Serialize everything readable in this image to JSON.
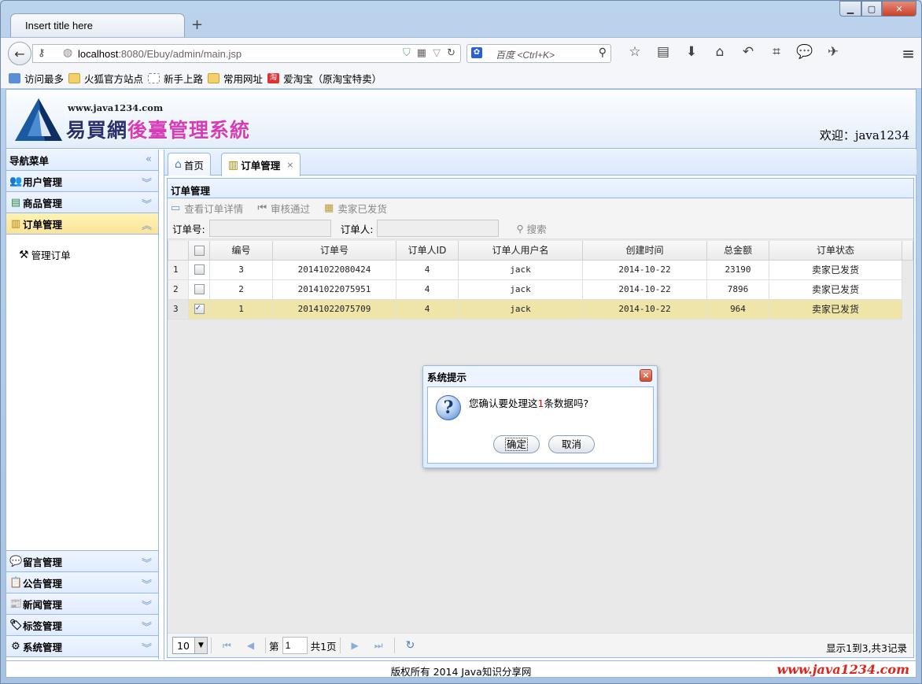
{
  "browser": {
    "tab_title": "Insert title here",
    "new_tab": "+",
    "url_host": "localhost",
    "url_rest": ":8080/Ebuy/admin/main.jsp",
    "search_placeholder": "百度 <Ctrl+K>",
    "bookmarks": [
      "访问最多",
      "火狐官方站点",
      "新手上路",
      "常用网址",
      "爱淘宝（原淘宝特卖）"
    ]
  },
  "header": {
    "site_url": "www.java1234.com",
    "title_part1": "易買網",
    "title_part2": "後臺管理系統",
    "welcome": "欢迎：java1234"
  },
  "nav": {
    "title": "导航菜单",
    "groups_top": [
      {
        "label": "用户管理",
        "icon": "users-icon"
      },
      {
        "label": "商品管理",
        "icon": "list-icon"
      },
      {
        "label": "订单管理",
        "icon": "order-icon"
      }
    ],
    "order_items": [
      {
        "label": "管理订单",
        "icon": "tools-icon"
      }
    ],
    "groups_bottom": [
      {
        "label": "留言管理",
        "icon": "comment-icon"
      },
      {
        "label": "公告管理",
        "icon": "notice-icon"
      },
      {
        "label": "新闻管理",
        "icon": "news-icon"
      },
      {
        "label": "标签管理",
        "icon": "tag-icon"
      },
      {
        "label": "系统管理",
        "icon": "gear-icon"
      }
    ]
  },
  "tabs": [
    {
      "label": "首页"
    },
    {
      "label": "订单管理",
      "close": "×"
    }
  ],
  "content": {
    "title": "订单管理",
    "toolbar": [
      "查看订单详情",
      "审核通过",
      "卖家已发货"
    ],
    "search": {
      "order_no_label": "订单号:",
      "user_label": "订单人:",
      "button": "搜索"
    }
  },
  "grid": {
    "columns": [
      "编号",
      "订单号",
      "订单人ID",
      "订单人用户名",
      "创建时间",
      "总金额",
      "订单状态"
    ],
    "rows": [
      {
        "rownum": "1",
        "checked": false,
        "id": "3",
        "order_no": "20141022080424",
        "user_id": "4",
        "username": "jack",
        "created": "2014-10-22",
        "total": "23190",
        "status": "卖家已发货"
      },
      {
        "rownum": "2",
        "checked": false,
        "id": "2",
        "order_no": "20141022075951",
        "user_id": "4",
        "username": "jack",
        "created": "2014-10-22",
        "total": "7896",
        "status": "卖家已发货"
      },
      {
        "rownum": "3",
        "checked": true,
        "id": "1",
        "order_no": "20141022075709",
        "user_id": "4",
        "username": "jack",
        "created": "2014-10-22",
        "total": "964",
        "status": "卖家已发货"
      }
    ]
  },
  "pager": {
    "page_size": "10",
    "page_prefix": "第",
    "page_value": "1",
    "page_suffix": "共1页",
    "info": "显示1到3,共3记录"
  },
  "footer": {
    "copyright": "版权所有 2014 Java知识分享网",
    "watermark": "www.java1234.com"
  },
  "dialog": {
    "title": "系统提示",
    "close": "×",
    "msg_before": "您确认要处理这",
    "msg_count": "1",
    "msg_after": "条数据吗?",
    "ok": "确定",
    "cancel": "取消",
    "icon": "?"
  },
  "colors": {
    "accent": "#95b8e7",
    "selected_row": "#f0e5a8",
    "selected_nav": "#fbe39a",
    "watermark": "#e0231b"
  }
}
